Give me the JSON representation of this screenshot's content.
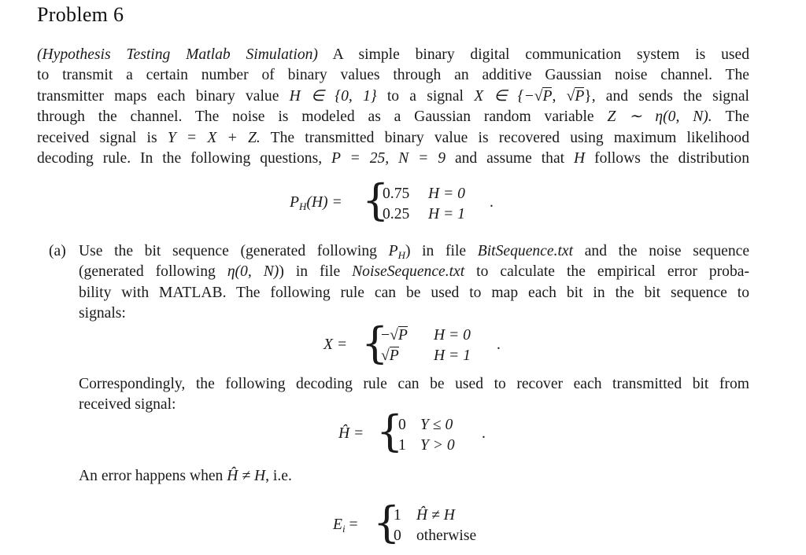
{
  "document": {
    "title": "Problem 6",
    "intro": {
      "italic_heading": "(Hypothesis Testing Matlab Simulation)",
      "lines": [
        " A simple binary digital communication system is used",
        "to transmit a certain number of binary values through an additive Gaussian noise channel.  The",
        "transmitter maps each binary value ",
        "through the channel.  The noise is modeled as a Gaussian random variable ",
        "received signal is ",
        "decoding rule. In the following questions, "
      ],
      "line3_math_H": "H ∈ {0, 1}",
      "line3_mid": " to a signal ",
      "line3_math_X": "X ∈ {−",
      "line3_tail": ", and sends the signal",
      "line4_math": "Z ∼ η(0, N).",
      "line4_tail": "  The",
      "line5_math": "Y = X + Z.",
      "line5_tail": " The transmitted binary value is recovered using maximum likelihood",
      "line6_math_P": "P = 25,",
      "line6_math_N": "N = 9",
      "line6_mid": " and assume that ",
      "line6_H": "H",
      "line6_tail": " follows the distribution"
    },
    "eq_prior": {
      "lhs": "P",
      "lhs_sub": "H",
      "lhs_arg": "(H) =",
      "cases": [
        {
          "value": "0.75",
          "condition": "H = 0"
        },
        {
          "value": "0.25",
          "condition": "H = 1"
        }
      ],
      "end": "."
    },
    "part_a": {
      "label": "(a)",
      "lines": [
        "Use the bit sequence (generated following ",
        ") in file ",
        " and the noise sequence",
        "(generated following ",
        ") in file ",
        " to calculate the empirical error proba-",
        "bility with MATLAB. The following rule can be used to map each bit in the bit sequence to",
        "signals:"
      ],
      "ph": "P",
      "ph_sub": "H",
      "file_bits": "BitSequence.txt",
      "eta": "η(0, N)",
      "file_noise": "NoiseSequence.txt"
    },
    "eq_map": {
      "lhs": "X =",
      "cases": [
        {
          "value_sign": "−",
          "value": "P",
          "condition": "H = 0"
        },
        {
          "value_sign": "",
          "value": "P",
          "condition": "H = 1"
        }
      ],
      "end": "."
    },
    "decoding_text": [
      "Correspondingly, the following decoding rule can be used to recover each transmitted bit from",
      "received signal:"
    ],
    "eq_decode": {
      "lhs": "Ĥ =",
      "cases": [
        {
          "value": "0",
          "condition": "Y ≤ 0"
        },
        {
          "value": "1",
          "condition": "Y > 0"
        }
      ],
      "end": "."
    },
    "error_text": {
      "prefix": "An error happens when ",
      "math": "Ĥ ≠ H",
      "suffix": ", i.e."
    },
    "eq_error": {
      "lhs": "E",
      "lhs_sub": "i",
      "lhs_eq": " =",
      "cases": [
        {
          "value": "1",
          "condition": "Ĥ ≠ H"
        },
        {
          "value": "0",
          "condition": "otherwise"
        }
      ]
    },
    "symbols": {
      "sqrt": "√",
      "left_brace": "{",
      "set_close": "}",
      "comma": ", "
    }
  }
}
